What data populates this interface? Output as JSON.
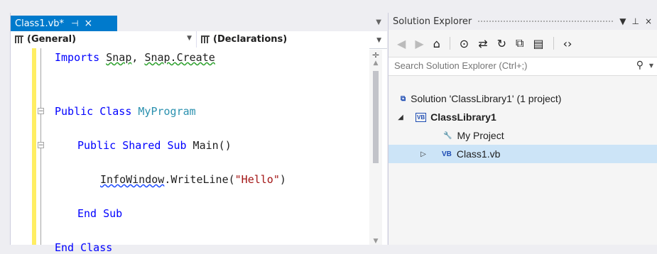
{
  "editor": {
    "tab": {
      "title": "Class1.vb*",
      "pin": "⊣",
      "close": "×"
    },
    "nav": {
      "left": "(General)",
      "right": "(Declarations)"
    },
    "code": {
      "l1": {
        "kw": "Imports",
        "sp": " ",
        "a": "Snap",
        "comma": ", ",
        "b": "Snap.Create"
      },
      "l2": {
        "kw1": "Public",
        "sp1": " ",
        "kw2": "Class",
        "sp2": " ",
        "name": "MyProgram"
      },
      "l3": {
        "kw1": "Public",
        "sp1": " ",
        "kw2": "Shared",
        "sp2": " ",
        "kw3": "Sub",
        "rest": " Main()"
      },
      "l4": {
        "obj": "InfoWindow",
        "call": ".WriteLine(",
        "str": "\"Hello\"",
        "close": ")"
      },
      "l5": {
        "kw1": "End",
        "sp": " ",
        "kw2": "Sub"
      },
      "l6": {
        "kw1": "End",
        "sp": " ",
        "kw2": "Class"
      }
    }
  },
  "solution_explorer": {
    "title": "Solution Explorer",
    "header_buttons": {
      "dropdown": "▼",
      "pin": "⊥",
      "close": "×"
    },
    "search": {
      "placeholder": "Search Solution Explorer (Ctrl+;)"
    },
    "tree": {
      "solution": "Solution 'ClassLibrary1' (1 project)",
      "project": "ClassLibrary1",
      "my_project": "My Project",
      "class_file": "Class1.vb"
    }
  }
}
